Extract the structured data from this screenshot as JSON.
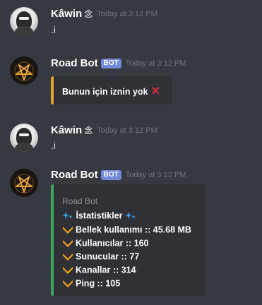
{
  "messages": [
    {
      "username": "Kâwin",
      "username_decoration": "念",
      "timestamp": "Today at 3:12 PM",
      "text": ".i",
      "avatar_icon": "masked-figure-avatar"
    },
    {
      "username": "Road Bot",
      "badge": "BOT",
      "timestamp": "Today at 3:12 PM",
      "avatar_icon": "pentagram-avatar",
      "embed": {
        "accent_color": "#e2a42b",
        "description": "Bunun için iznin yok",
        "emoji": "✕"
      }
    },
    {
      "username": "Kâwin",
      "username_decoration": "念",
      "timestamp": "Today at 3:12 PM",
      "text": ".i",
      "avatar_icon": "masked-figure-avatar"
    },
    {
      "username": "Road Bot",
      "badge": "BOT",
      "timestamp": "Today at 3:12 PM",
      "avatar_icon": "pentagram-avatar",
      "embed": {
        "accent_color": "#3ba55c",
        "author": "Road Bot",
        "title": "İstatistikler",
        "stats": [
          "Bellek kullanımı :: 45.68 MB",
          "Kullanıcılar :: 160",
          "Sunucular :: 77",
          "Kanallar :: 314",
          "Ping :: 105"
        ]
      }
    }
  ],
  "colors": {
    "background": "#36393f",
    "embed_background": "#2f3136",
    "bot_badge": "#7289da",
    "chevron": "#f4a21b",
    "sparkle": "#3fa9f5"
  }
}
